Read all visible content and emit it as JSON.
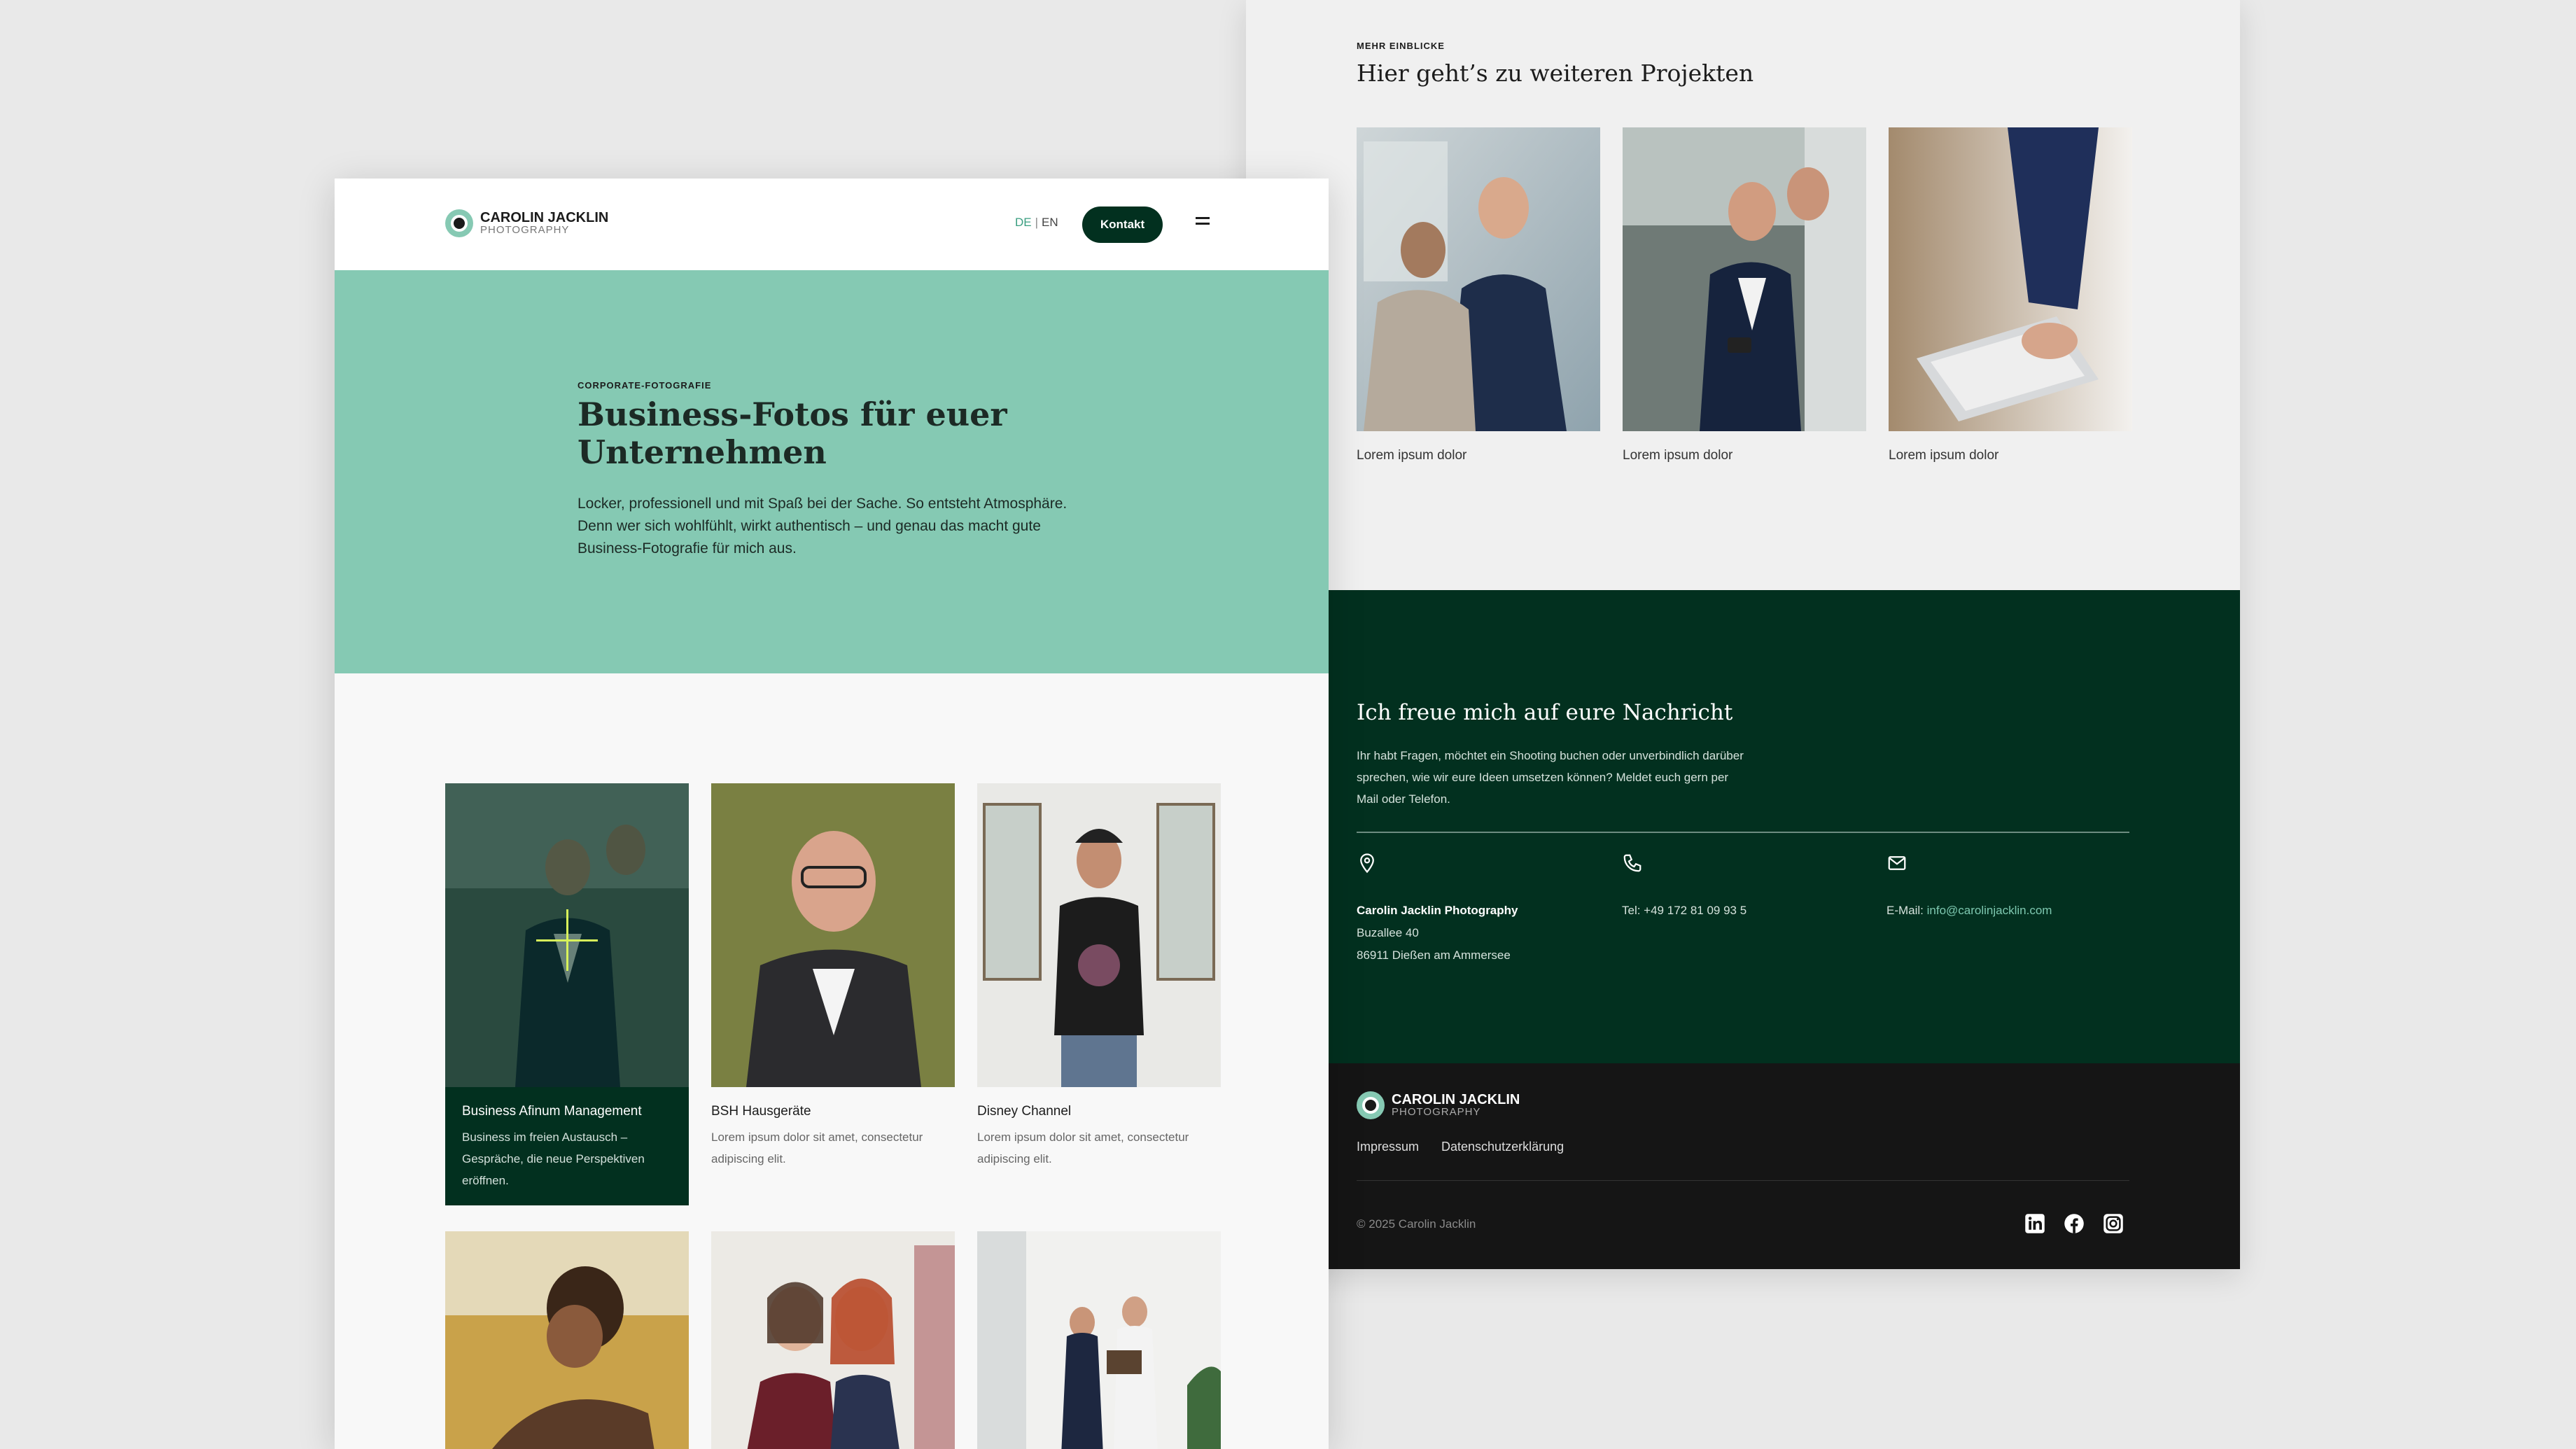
{
  "brand": {
    "name": "CAROLIN JACKLIN",
    "sub": "PHOTOGRAPHY"
  },
  "header": {
    "lang_de": "DE",
    "lang_sep": "|",
    "lang_en": "EN",
    "contact_button": "Kontakt",
    "menu_icon": "hamburger-icon"
  },
  "hero": {
    "eyebrow": "CORPORATE-FOTOGRAFIE",
    "title": "Business-Fotos für euer Unternehmen",
    "text": "Locker, professionell und mit Spaß bei der Sache. So entsteht Atmosphäre. Denn wer sich wohlfühlt, wirkt authentisch – und genau das macht gute Business-Fotografie für mich aus."
  },
  "work": [
    {
      "title": "Business Afinum Management",
      "desc": "Business im freien Austausch – Gespräche, die neue Perspektiven eröffnen."
    },
    {
      "title": "BSH Hausgeräte",
      "desc": "Lorem ipsum dolor sit amet, consectetur adipiscing elit."
    },
    {
      "title": "Disney Channel",
      "desc": "Lorem ipsum dolor sit amet, consectetur adipiscing elit."
    }
  ],
  "projects": {
    "eyebrow": "MEHR EINBLICKE",
    "title": "Hier geht’s zu weiteren Projekten",
    "items": [
      {
        "caption": "Lorem ipsum dolor"
      },
      {
        "caption": "Lorem ipsum dolor"
      },
      {
        "caption": "Lorem ipsum dolor"
      }
    ]
  },
  "contact": {
    "title": "Ich freue mich auf eure Nachricht",
    "intro": "Ihr habt Fragen, möchtet ein Shooting buchen oder unverbindlich darüber sprechen, wie wir eure Ideen umsetzen können? Meldet euch gern per Mail oder Telefon.",
    "address_name": "Carolin Jacklin Photography",
    "address_street": "Buzallee 40",
    "address_city": "86911 Dießen am Ammersee",
    "phone": "Tel: +49 172 81 09 93 5",
    "email_label": "E-Mail:",
    "email": "info@carolinjacklin.com"
  },
  "footer": {
    "impressum": "Impressum",
    "privacy": "Datenschutzerklärung",
    "copyright": "© 2025 Carolin Jacklin",
    "socials": [
      "linkedin-icon",
      "facebook-icon",
      "instagram-icon"
    ]
  },
  "colors": {
    "mint": "#85c9b3",
    "dark_green": "#02301f",
    "footer_black": "#151515",
    "accent_text": "#3a9e80"
  }
}
